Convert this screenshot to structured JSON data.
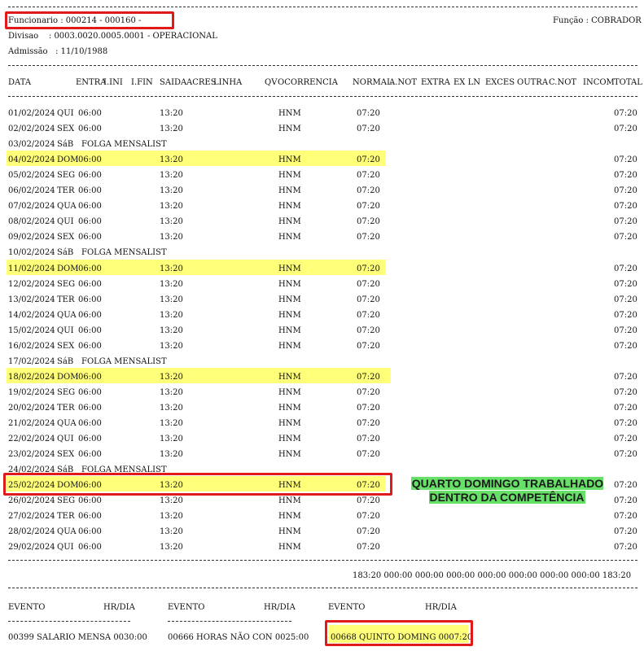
{
  "header": {
    "funcionario": "Funcionario : 000214 - 000160 -",
    "funcao": "Função : COBRADOR",
    "divisao": "Divisao    : 0003.0020.0005.0001 - OPERACIONAL",
    "admissao": "Admissão   : 11/10/1988"
  },
  "columns": [
    "DATA",
    "ENTRA",
    "I.INI",
    "I.FIN",
    "SAIDA",
    "ACRES",
    "LINHA",
    "QV",
    "OCORRENCIA",
    "NORMAL",
    "A.NOT",
    "EXTRA",
    "EX LN",
    "EXCES",
    "OUTRA",
    "C.NOT",
    "INCOM",
    "TOTAL"
  ],
  "rows": [
    {
      "date": "01/02/2024",
      "day": "QUI",
      "entra": "06:00",
      "saida": "13:20",
      "ocorr": "HNM",
      "normal": "07:20",
      "total": "07:20"
    },
    {
      "date": "02/02/2024",
      "day": "SEX",
      "entra": "06:00",
      "saida": "13:20",
      "ocorr": "HNM",
      "normal": "07:20",
      "total": "07:20"
    },
    {
      "date": "03/02/2024",
      "day": "SáB",
      "folga": "FOLGA MENSALIST"
    },
    {
      "date": "04/02/2024",
      "day": "DOM",
      "entra": "06:00",
      "saida": "13:20",
      "ocorr": "HNM",
      "normal": "07:20",
      "total": "07:20",
      "hl": true
    },
    {
      "date": "05/02/2024",
      "day": "SEG",
      "entra": "06:00",
      "saida": "13:20",
      "ocorr": "HNM",
      "normal": "07:20",
      "total": "07:20"
    },
    {
      "date": "06/02/2024",
      "day": "TER",
      "entra": "06:00",
      "saida": "13:20",
      "ocorr": "HNM",
      "normal": "07:20",
      "total": "07:20"
    },
    {
      "date": "07/02/2024",
      "day": "QUA",
      "entra": "06:00",
      "saida": "13:20",
      "ocorr": "HNM",
      "normal": "07:20",
      "total": "07:20"
    },
    {
      "date": "08/02/2024",
      "day": "QUI",
      "entra": "06:00",
      "saida": "13:20",
      "ocorr": "HNM",
      "normal": "07:20",
      "total": "07:20"
    },
    {
      "date": "09/02/2024",
      "day": "SEX",
      "entra": "06:00",
      "saida": "13:20",
      "ocorr": "HNM",
      "normal": "07:20",
      "total": "07:20"
    },
    {
      "date": "10/02/2024",
      "day": "SáB",
      "folga": "FOLGA MENSALIST"
    },
    {
      "date": "11/02/2024",
      "day": "DOM",
      "entra": "06:00",
      "saida": "13:20",
      "ocorr": "HNM",
      "normal": "07:20",
      "total": "07:20",
      "hl": true
    },
    {
      "date": "12/02/2024",
      "day": "SEG",
      "entra": "06:00",
      "saida": "13:20",
      "ocorr": "HNM",
      "normal": "07:20",
      "total": "07:20"
    },
    {
      "date": "13/02/2024",
      "day": "TER",
      "entra": "06:00",
      "saida": "13:20",
      "ocorr": "HNM",
      "normal": "07:20",
      "total": "07:20"
    },
    {
      "date": "14/02/2024",
      "day": "QUA",
      "entra": "06:00",
      "saida": "13:20",
      "ocorr": "HNM",
      "normal": "07:20",
      "total": "07:20"
    },
    {
      "date": "15/02/2024",
      "day": "QUI",
      "entra": "06:00",
      "saida": "13:20",
      "ocorr": "HNM",
      "normal": "07:20",
      "total": "07:20"
    },
    {
      "date": "16/02/2024",
      "day": "SEX",
      "entra": "06:00",
      "saida": "13:20",
      "ocorr": "HNM",
      "normal": "07:20",
      "total": "07:20"
    },
    {
      "date": "17/02/2024",
      "day": "SáB",
      "folga": "FOLGA MENSALIST"
    },
    {
      "date": "18/02/2024",
      "day": "DOM",
      "entra": "06:00",
      "saida": "13:20",
      "ocorr": "HNM",
      "normal": "07:20",
      "total": "07:20",
      "hl": true
    },
    {
      "date": "19/02/2024",
      "day": "SEG",
      "entra": "06:00",
      "saida": "13:20",
      "ocorr": "HNM",
      "normal": "07:20",
      "total": "07:20"
    },
    {
      "date": "20/02/2024",
      "day": "TER",
      "entra": "06:00",
      "saida": "13:20",
      "ocorr": "HNM",
      "normal": "07:20",
      "total": "07:20"
    },
    {
      "date": "21/02/2024",
      "day": "QUA",
      "entra": "06:00",
      "saida": "13:20",
      "ocorr": "HNM",
      "normal": "07:20",
      "total": "07:20"
    },
    {
      "date": "22/02/2024",
      "day": "QUI",
      "entra": "06:00",
      "saida": "13:20",
      "ocorr": "HNM",
      "normal": "07:20",
      "total": "07:20"
    },
    {
      "date": "23/02/2024",
      "day": "SEX",
      "entra": "06:00",
      "saida": "13:20",
      "ocorr": "HNM",
      "normal": "07:20",
      "total": "07:20"
    },
    {
      "date": "24/02/2024",
      "day": "SáB",
      "folga": "FOLGA MENSALIST"
    },
    {
      "date": "25/02/2024",
      "day": "DOM",
      "entra": "06:00",
      "saida": "13:20",
      "ocorr": "HNM",
      "normal": "07:20",
      "total": "07:20",
      "hl": true,
      "boxed": true
    },
    {
      "date": "26/02/2024",
      "day": "SEG",
      "entra": "06:00",
      "saida": "13:20",
      "ocorr": "HNM",
      "normal": "07:20",
      "total": "07:20"
    },
    {
      "date": "27/02/2024",
      "day": "TER",
      "entra": "06:00",
      "saida": "13:20",
      "ocorr": "HNM",
      "normal": "07:20",
      "total": "07:20"
    },
    {
      "date": "28/02/2024",
      "day": "QUA",
      "entra": "06:00",
      "saida": "13:20",
      "ocorr": "HNM",
      "normal": "07:20",
      "total": "07:20"
    },
    {
      "date": "29/02/2024",
      "day": "QUI",
      "entra": "06:00",
      "saida": "13:20",
      "ocorr": "HNM",
      "normal": "07:20",
      "total": "07:20"
    }
  ],
  "annotation": "QUARTO DOMINGO TRABALHADO DENTRO DA COMPETÊNCIA",
  "totals": "183:20 000:00 000:00 000:00 000:00 000:00 000:00 000:00 183:20",
  "events": {
    "headers": [
      "EVENTO",
      "HR/DIA",
      "EVENTO",
      "HR/DIA",
      "EVENTO",
      "HR/DIA"
    ],
    "items": [
      "00399 SALARIO MENSA 0030:00",
      "00666 HORAS NÃO CON 0025:00",
      "00668 QUINTO DOMING 0007:20"
    ]
  },
  "colors": {
    "highlight": "#ffff7a",
    "box": "#e01a1a",
    "note": "#66e066"
  }
}
